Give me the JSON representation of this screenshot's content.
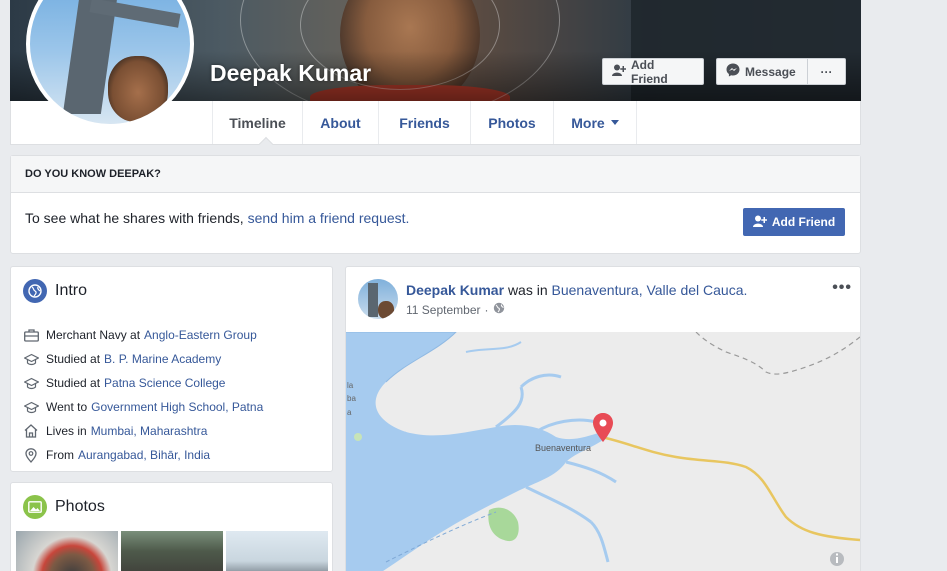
{
  "profile": {
    "name": "Deepak Kumar",
    "add_friend_label": "Add Friend",
    "message_label": "Message",
    "more_label": "···"
  },
  "nav": {
    "tabs": [
      {
        "label": "Timeline"
      },
      {
        "label": "About"
      },
      {
        "label": "Friends"
      },
      {
        "label": "Photos"
      },
      {
        "label": "More"
      }
    ]
  },
  "know": {
    "heading": "DO YOU KNOW DEEPAK?",
    "text": "To see what he shares with friends,",
    "link": "send him a friend request.",
    "button_label": "Add Friend"
  },
  "intro": {
    "title": "Intro",
    "items": [
      {
        "icon": "briefcase-icon",
        "prefix": "Merchant Navy at",
        "link": "Anglo-Eastern Group"
      },
      {
        "icon": "graduation-cap-icon",
        "prefix": "Studied at",
        "link": "B. P. Marine Academy"
      },
      {
        "icon": "graduation-cap-icon",
        "prefix": "Studied at",
        "link": "Patna Science College"
      },
      {
        "icon": "graduation-cap-icon",
        "prefix": "Went to",
        "link": "Government High School, Patna"
      },
      {
        "icon": "home-icon",
        "prefix": "Lives in",
        "link": "Mumbai, Maharashtra"
      },
      {
        "icon": "location-pin-icon",
        "prefix": "From",
        "link": "Aurangabad, Bihār, India"
      }
    ]
  },
  "photos": {
    "title": "Photos"
  },
  "post": {
    "author": "Deepak Kumar",
    "verb": "was in",
    "place": "Buenaventura, Valle del Cauca.",
    "date": "11 September",
    "separator": "·",
    "more_label": "•••",
    "map_label": "Buenaventura",
    "map_edge_label_1": "la",
    "map_edge_label_2": "ba",
    "map_edge_label_3": "a"
  },
  "colors": {
    "link": "#365899",
    "primary": "#4267b2",
    "page_bg": "#e9ebee",
    "map_water": "#a6cbef",
    "map_land": "#ececec",
    "map_road": "#e8c660",
    "pin": "#e84b55"
  }
}
